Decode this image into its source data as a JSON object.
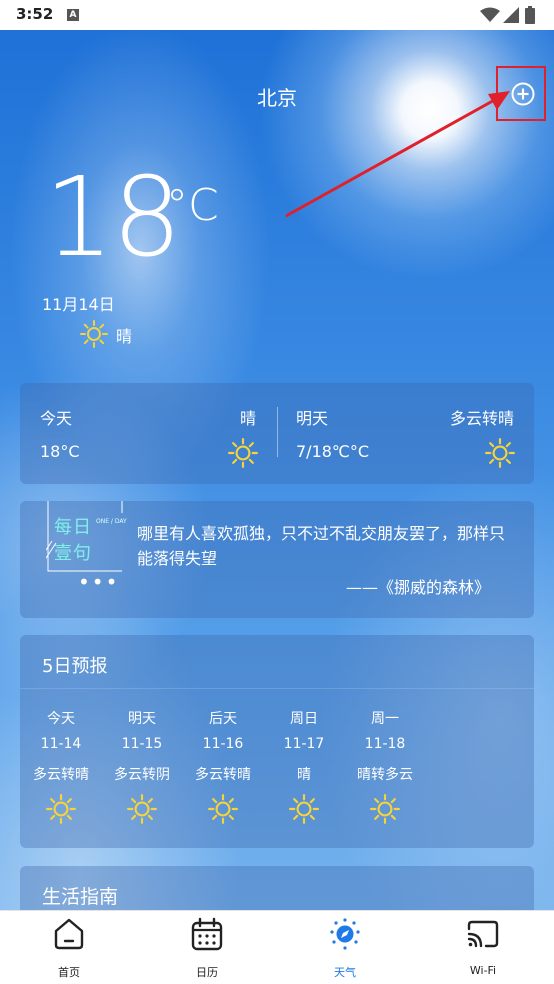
{
  "status_bar": {
    "time": "3:52",
    "notification_letter": "A"
  },
  "header": {
    "city": "北京"
  },
  "current": {
    "temperature": "18",
    "unit": "°C",
    "date": "11月14日",
    "condition": "晴"
  },
  "today_tomorrow": {
    "today": {
      "label": "今天",
      "condition": "晴",
      "temp": "18°C"
    },
    "tomorrow": {
      "label": "明天",
      "condition": "多云转晴",
      "temp": "7/18℃°C"
    }
  },
  "daily_quote": {
    "badge_line1": "每日",
    "badge_line2": "壹句",
    "badge_small": "ONE / DAY",
    "dots": "•••",
    "text": "哪里有人喜欢孤独，只不过不乱交朋友罢了，那样只能落得失望",
    "source": "——《挪威的森林》"
  },
  "forecast": {
    "title": "5日预报",
    "days": [
      {
        "day": "今天",
        "date": "11-14",
        "condition": "多云转晴"
      },
      {
        "day": "明天",
        "date": "11-15",
        "condition": "多云转阴"
      },
      {
        "day": "后天",
        "date": "11-16",
        "condition": "多云转晴"
      },
      {
        "day": "周日",
        "date": "11-17",
        "condition": "晴"
      },
      {
        "day": "周一",
        "date": "11-18",
        "condition": "晴转多云"
      }
    ]
  },
  "life_guide": {
    "title": "生活指南"
  },
  "tabs": [
    {
      "label": "首页",
      "icon": "home-icon"
    },
    {
      "label": "日历",
      "icon": "calendar-icon"
    },
    {
      "label": "天气",
      "icon": "compass-icon",
      "active": true
    },
    {
      "label": "Wi-Fi",
      "icon": "cast-icon"
    }
  ],
  "colors": {
    "accent": "#1d7ae8",
    "highlight_box": "#e0202a",
    "sun": "#f5d33c",
    "quote_badge": "#7ff0e8"
  }
}
